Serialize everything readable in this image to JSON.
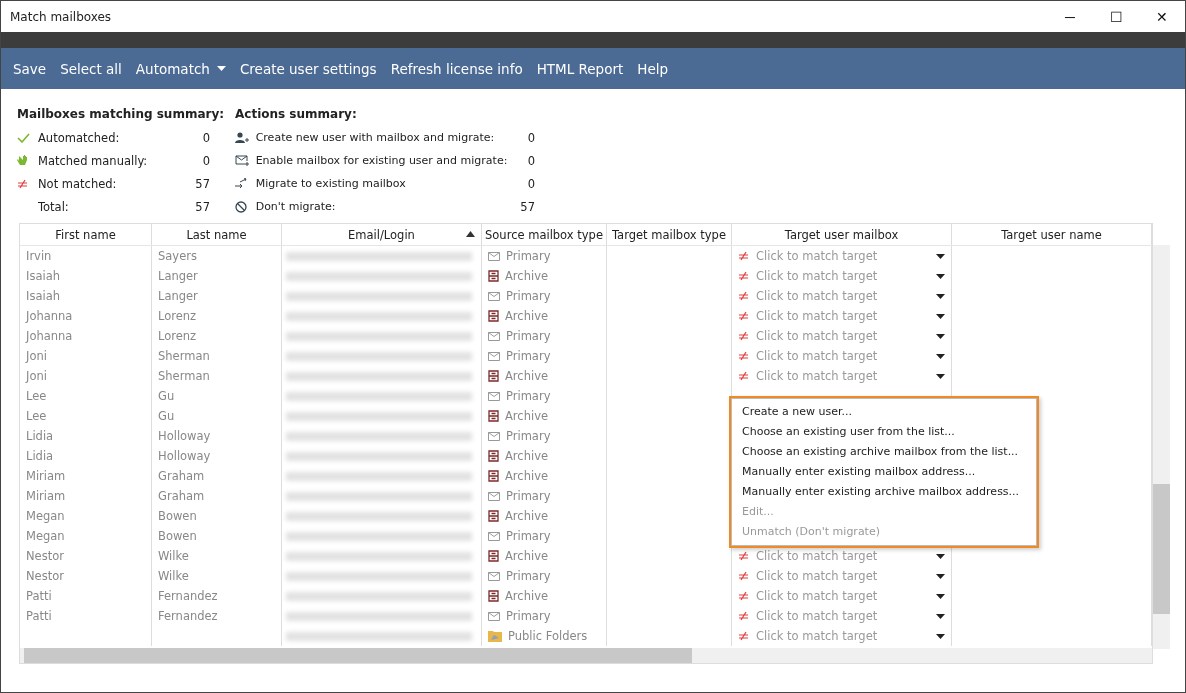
{
  "window": {
    "title": "Match mailboxes",
    "controls": [
      "─",
      "☐",
      "✕"
    ]
  },
  "toolbar": [
    {
      "label": "Save",
      "dropdown": false
    },
    {
      "label": "Select all",
      "dropdown": false
    },
    {
      "label": "Automatch",
      "dropdown": true
    },
    {
      "label": "Create user settings",
      "dropdown": false
    },
    {
      "label": "Refresh license info",
      "dropdown": false
    },
    {
      "label": "HTML Report",
      "dropdown": false
    },
    {
      "label": "Help",
      "dropdown": false
    }
  ],
  "matching_summary": {
    "title": "Mailboxes matching summary:",
    "items": [
      {
        "kind": "auto",
        "label": "Automatched:",
        "count": "0"
      },
      {
        "kind": "manual",
        "label": "Matched manually:",
        "count": "0"
      },
      {
        "kind": "unmatched",
        "label": "Not matched:",
        "count": "57"
      },
      {
        "kind": "total",
        "label": "Total:",
        "count": "57"
      }
    ]
  },
  "actions_summary": {
    "title": "Actions summary:",
    "items": [
      {
        "kind": "create",
        "label": "Create new user with mailbox and migrate:",
        "count": "0"
      },
      {
        "kind": "enable",
        "label": "Enable mailbox for existing user and migrate:",
        "count": "0"
      },
      {
        "kind": "migrate",
        "label": "Migrate to existing mailbox",
        "count": "0"
      },
      {
        "kind": "skip",
        "label": "Don't migrate:",
        "count": "57"
      }
    ]
  },
  "table": {
    "columns": [
      {
        "label": "First name",
        "sorted": false
      },
      {
        "label": "Last name",
        "sorted": false
      },
      {
        "label": "Email/Login",
        "sorted": true
      },
      {
        "label": "Source mailbox type",
        "sorted": false
      },
      {
        "label": "Target mailbox type",
        "sorted": false
      },
      {
        "label": "Target user mailbox",
        "sorted": false
      },
      {
        "label": "Target user name",
        "sorted": false
      }
    ],
    "rows": [
      {
        "first": "Irvin",
        "last": "Sayers",
        "kind": "primary",
        "source": "Primary",
        "target": "Click to match target"
      },
      {
        "first": "Isaiah",
        "last": "Langer",
        "kind": "archive",
        "source": "Archive",
        "target": "Click to match target"
      },
      {
        "first": "Isaiah",
        "last": "Langer",
        "kind": "primary",
        "source": "Primary",
        "target": "Click to match target"
      },
      {
        "first": "Johanna",
        "last": "Lorenz",
        "kind": "archive",
        "source": "Archive",
        "target": "Click to match target"
      },
      {
        "first": "Johanna",
        "last": "Lorenz",
        "kind": "primary",
        "source": "Primary",
        "target": "Click to match target"
      },
      {
        "first": "Joni",
        "last": "Sherman",
        "kind": "primary",
        "source": "Primary",
        "target": "Click to match target"
      },
      {
        "first": "Joni",
        "last": "Sherman",
        "kind": "archive",
        "source": "Archive",
        "target": "Click to match target"
      },
      {
        "first": "Lee",
        "last": "Gu",
        "kind": "primary",
        "source": "Primary"
      },
      {
        "first": "Lee",
        "last": "Gu",
        "kind": "archive",
        "source": "Archive"
      },
      {
        "first": "Lidia",
        "last": "Holloway",
        "kind": "primary",
        "source": "Primary"
      },
      {
        "first": "Lidia",
        "last": "Holloway",
        "kind": "archive",
        "source": "Archive"
      },
      {
        "first": "Miriam",
        "last": "Graham",
        "kind": "archive",
        "source": "Archive"
      },
      {
        "first": "Miriam",
        "last": "Graham",
        "kind": "primary",
        "source": "Primary"
      },
      {
        "first": "Megan",
        "last": "Bowen",
        "kind": "archive",
        "source": "Archive"
      },
      {
        "first": "Megan",
        "last": "Bowen",
        "kind": "primary",
        "source": "Primary"
      },
      {
        "first": "Nestor",
        "last": "Wilke",
        "kind": "archive",
        "source": "Archive",
        "target": "Click to match target"
      },
      {
        "first": "Nestor",
        "last": "Wilke",
        "kind": "primary",
        "source": "Primary",
        "target": "Click to match target"
      },
      {
        "first": "Patti",
        "last": "Fernandez",
        "kind": "archive",
        "source": "Archive",
        "target": "Click to match target"
      },
      {
        "first": "Patti",
        "last": "Fernandez",
        "kind": "primary",
        "source": "Primary",
        "target": "Click to match target"
      },
      {
        "kind": "public",
        "source": "Public Folders",
        "target": "Click to match target"
      }
    ]
  },
  "context_menu": {
    "items": [
      {
        "label": "Create a new user...",
        "disabled": false
      },
      {
        "label": "Choose an existing user from the list...",
        "disabled": false
      },
      {
        "label": "Choose an existing archive mailbox from the list...",
        "disabled": false
      },
      {
        "label": "Manually enter existing mailbox address...",
        "disabled": false
      },
      {
        "label": "Manually enter existing archive mailbox address...",
        "disabled": false
      },
      {
        "label": "Edit...",
        "disabled": true
      },
      {
        "label": "Unmatch (Don't migrate)",
        "disabled": true
      }
    ]
  }
}
